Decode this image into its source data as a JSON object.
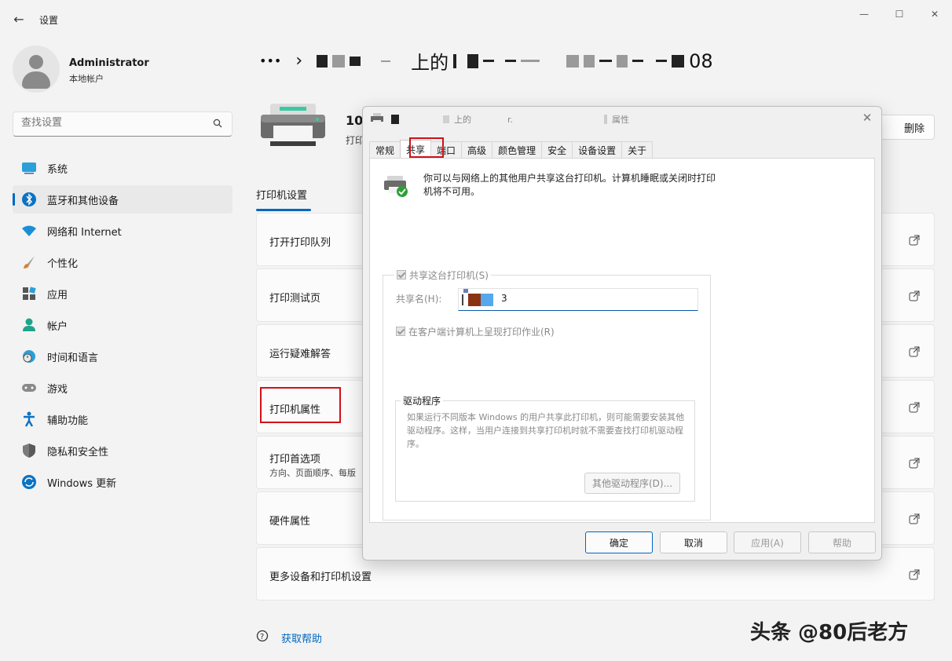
{
  "app": {
    "title": "设置",
    "back_label": "←",
    "minimize": "—",
    "maximize": "☐",
    "close": "✕"
  },
  "user": {
    "name": "Administrator",
    "account_type": "本地帐户"
  },
  "search": {
    "placeholder": "查找设置"
  },
  "sidebar": {
    "items": [
      {
        "label": "系统",
        "icon": "system-icon"
      },
      {
        "label": "蓝牙和其他设备",
        "icon": "bluetooth-icon",
        "active": true
      },
      {
        "label": "网络和 Internet",
        "icon": "wifi-icon"
      },
      {
        "label": "个性化",
        "icon": "brush-icon"
      },
      {
        "label": "应用",
        "icon": "apps-icon"
      },
      {
        "label": "帐户",
        "icon": "account-icon"
      },
      {
        "label": "时间和语言",
        "icon": "clock-globe-icon"
      },
      {
        "label": "游戏",
        "icon": "gamepad-icon"
      },
      {
        "label": "辅助功能",
        "icon": "accessibility-icon"
      },
      {
        "label": "隐私和安全性",
        "icon": "shield-icon"
      },
      {
        "label": "Windows 更新",
        "icon": "update-icon"
      }
    ]
  },
  "main": {
    "breadcrumb_more": "•••",
    "breadcrumb_sep": "›",
    "breadcrumb_title_part1": "上的",
    "breadcrumb_title_tail": "08",
    "printer_title": "10.",
    "printer_sub": "打印",
    "delete_label": "删除",
    "tab_label": "打印机设置",
    "cards": [
      {
        "title": "打开打印队列"
      },
      {
        "title": "打印测试页"
      },
      {
        "title": "运行疑难解答"
      },
      {
        "title": "打印机属性"
      },
      {
        "title": "打印首选项",
        "subtitle": "方向、页面顺序、每版"
      },
      {
        "title": "硬件属性"
      },
      {
        "title": "更多设备和打印机设置"
      }
    ],
    "help_label": "获取帮助"
  },
  "dialog": {
    "title_part1": "上的",
    "title_part2": "r.",
    "title_part3": "属性",
    "tabs": [
      "常规",
      "共享",
      "端口",
      "高级",
      "颜色管理",
      "安全",
      "设备设置",
      "关于"
    ],
    "active_tab": "共享",
    "description": "你可以与网络上的其他用户共享这台打印机。计算机睡眠或关闭时打印机将不可用。",
    "share_checkbox": "共享这台打印机(S)",
    "share_name_label": "共享名(H):",
    "share_name_value": "3",
    "render_checkbox": "在客户端计算机上呈现打印作业(R)",
    "drivers_group": "驱动程序",
    "drivers_text": "如果运行不同版本 Windows 的用户共享此打印机，则可能需要安装其他驱动程序。这样，当用户连接到共享打印机时就不需要查找打印机驱动程序。",
    "drivers_button": "其他驱动程序(D)...",
    "buttons": {
      "ok": "确定",
      "cancel": "取消",
      "apply": "应用(A)",
      "help": "帮助"
    }
  },
  "watermark": "头条 @80后老方",
  "colors": {
    "accent": "#0067c0",
    "highlight": "#d0101a"
  }
}
